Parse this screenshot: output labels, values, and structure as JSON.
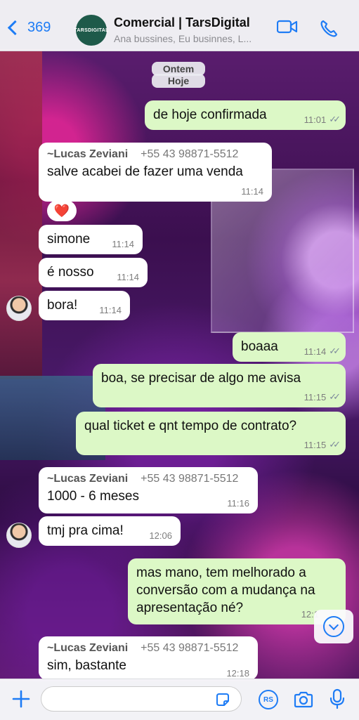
{
  "header": {
    "back_count": "369",
    "group_avatar_text": "TARSDIGITAL",
    "title": "Comercial | TarsDigital",
    "subtitle": "Ana bussines, Eu businnes, L..."
  },
  "date_chips": [
    "Ontem",
    "Hoje"
  ],
  "messages": [
    {
      "text": "de hoje confirmada",
      "time": "11:01"
    },
    {
      "sender": "~Lucas Zeviani",
      "phone": "+55 43 98871-5512",
      "text": "salve acabei de fazer uma venda",
      "time": "11:14"
    },
    {
      "reaction": "❤️"
    },
    {
      "text": "simone",
      "time": "11:14"
    },
    {
      "text": "é nosso",
      "time": "11:14"
    },
    {
      "text": "bora!",
      "time": "11:14"
    },
    {
      "text": "boaaa",
      "time": "11:14"
    },
    {
      "text": "boa, se precisar de algo me avisa",
      "time": "11:15"
    },
    {
      "text": "qual ticket e qnt tempo de contrato?",
      "time": "11:15"
    },
    {
      "sender": "~Lucas Zeviani",
      "phone": "+55 43 98871-5512",
      "text": "1000 - 6 meses",
      "time": "11:16"
    },
    {
      "text": "tmj pra cima!",
      "time": "12:06"
    },
    {
      "text": "mas mano, tem melhorado a conversão com a mudança na apresentação né?",
      "time": "12:1"
    },
    {
      "sender": "~Lucas Zeviani",
      "phone": "+55 43 98871-5512",
      "text": "sim, bastante",
      "time": "12:18"
    }
  ],
  "composer": {
    "rs_badge": "RS",
    "input_value": ""
  }
}
